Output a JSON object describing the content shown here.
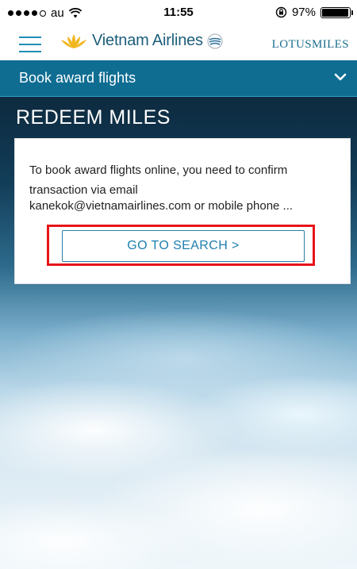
{
  "status_bar": {
    "carrier": "au",
    "time": "11:55",
    "battery_percent": "97%",
    "battery_level": 0.97,
    "signal_bars_filled": 4,
    "signal_bars_total": 5
  },
  "header": {
    "brand_name": "Vietnam Airlines",
    "program_name": "LOTUSMILES"
  },
  "section_bar": {
    "label": "Book award flights"
  },
  "page": {
    "heading": "REDEEM MILES"
  },
  "card": {
    "message_line_1": "To book award flights online, you need to confirm",
    "message_line_2": "transaction via email",
    "message_line_3": "kanekok@vietnamairlines.com or mobile phone ...",
    "button_label": "GO TO SEARCH >"
  },
  "colors": {
    "brand_blue": "#0f6d92",
    "link_blue": "#1d7fae",
    "lotus_gold": "#f2b71e",
    "highlight_red": "#e8141a"
  }
}
